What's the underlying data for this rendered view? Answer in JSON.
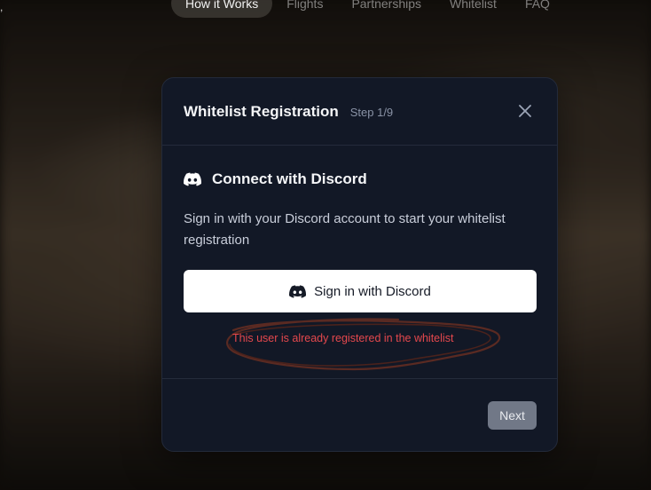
{
  "nav": {
    "items": [
      {
        "label": "How it Works",
        "active": true
      },
      {
        "label": "Flights",
        "active": false
      },
      {
        "label": "Partnerships",
        "active": false
      },
      {
        "label": "Whitelist",
        "active": false
      },
      {
        "label": "FAQ",
        "active": false
      }
    ]
  },
  "modal": {
    "title": "Whitelist Registration",
    "step": "Step 1/9",
    "close_icon": "close-icon",
    "section": {
      "icon": "discord-icon",
      "title": "Connect with Discord",
      "description": "Sign in with your Discord account to start your whitelist registration"
    },
    "signin_button": {
      "icon": "discord-icon",
      "label": "Sign in with Discord"
    },
    "error_message": "This user is already registered in the whitelist",
    "next_button": "Next"
  },
  "colors": {
    "modal_bg": "#121826",
    "error": "#e5484d",
    "annotation_scribble": "#5a2a22",
    "next_button_bg": "#717887"
  }
}
